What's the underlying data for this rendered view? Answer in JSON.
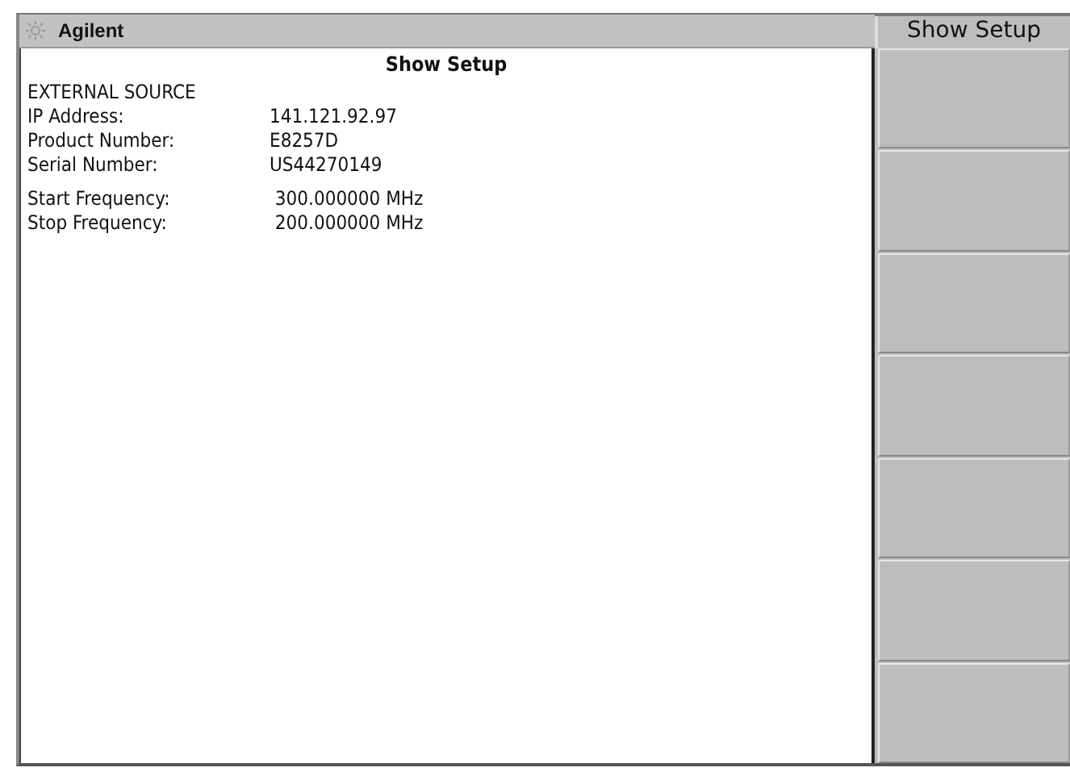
{
  "window": {
    "title": "Agilent"
  },
  "menu_title": "Show Setup",
  "panel": {
    "title": "Show Setup",
    "heading": "EXTERNAL SOURCE",
    "groups": [
      [
        {
          "label": "IP Address:",
          "value": "141.121.92.97"
        },
        {
          "label": "Product Number:",
          "value": "E8257D"
        },
        {
          "label": "Serial Number:",
          "value": "US44270149"
        }
      ],
      [
        {
          "label": "Start Frequency:",
          "value": " 300.000000 MHz"
        },
        {
          "label": "Stop Frequency:",
          "value": " 200.000000 MHz"
        }
      ]
    ]
  },
  "softkeys": [
    {
      "kind": "blank"
    },
    {
      "kind": "blank"
    },
    {
      "kind": "blank"
    },
    {
      "kind": "blank"
    },
    {
      "kind": "blank"
    },
    {
      "kind": "blank"
    },
    {
      "kind": "blank"
    }
  ]
}
